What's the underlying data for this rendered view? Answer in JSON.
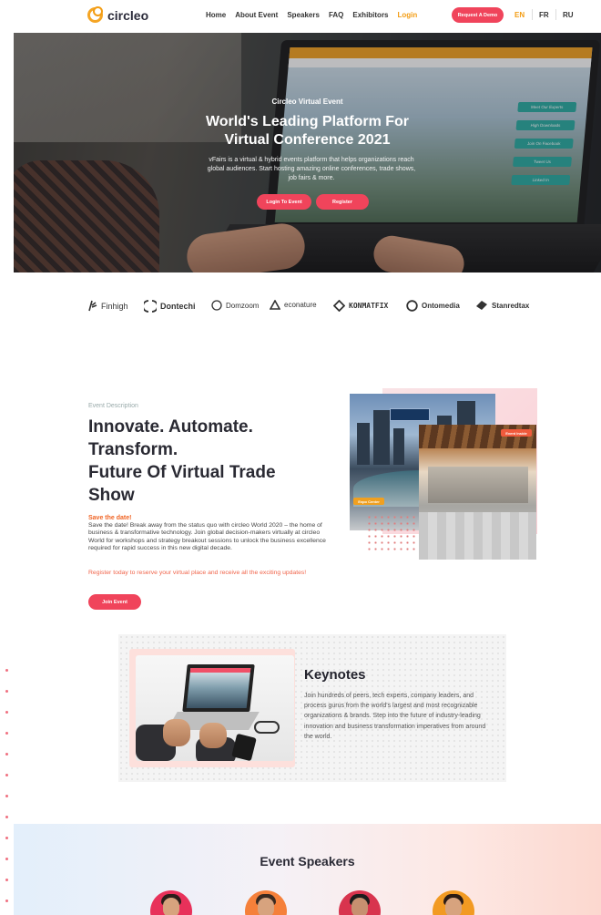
{
  "header": {
    "logo_text": "circleo",
    "nav": [
      "Home",
      "About Event",
      "Speakers",
      "FAQ",
      "Exhibitors",
      "Login"
    ],
    "demo_button": "Request A Demo",
    "languages": [
      "EN",
      "FR",
      "RU"
    ],
    "active_language": "EN"
  },
  "hero": {
    "eyebrow": "Circleo Virtual Event",
    "title_line1": "World's Leading Platform For",
    "title_line2": "Virtual Conference 2021",
    "description": "vFairs is a virtual & hybrid events platform that helps organizations reach global audiences. Start hosting amazing online conferences, trade shows, job fairs & more.",
    "login_button": "Login To Event",
    "register_button": "Register",
    "screen_panels": [
      "Meet Our Experts",
      "High Downloads",
      "Join On Facebook",
      "Tweet Us",
      "Linked In"
    ]
  },
  "partners": [
    "Finhigh",
    "Dontechi",
    "Domzoom",
    "econature",
    "KONMATFIX",
    "Ontomedia",
    "Stanredtax"
  ],
  "event": {
    "eyebrow": "Event Description",
    "title_lines": [
      "Innovate. Automate.",
      "Transform.",
      "Future Of Virtual Trade",
      "Show"
    ],
    "save_heading": "Save the date!",
    "body": "Save the date! Break away from the status quo with circleo World 2020 – the home of business & transformative technology. Join global decision-makers virtually at circleo World for workshops and strategy breakout sessions to unlock the business excellence required for rapid success in this new digital decade.",
    "register_text": "Register today to reserve your virtual place and receive all the exciting updates!",
    "join_button": "Join Event",
    "image_tags": [
      "Event Inside",
      "Expo Center"
    ]
  },
  "keynotes": {
    "title": "Keynotes",
    "text": "Join hundreds of peers, tech experts, company leaders, and process gurus from the world's largest and most recognizable organizations & brands. Step into the future of industry-leading innovation and business transformation imperatives from around the world."
  },
  "speakers": {
    "title": "Event Speakers"
  },
  "colors": {
    "accent_red": "#f0445b",
    "accent_orange": "#f39c12",
    "heading": "#2a2a33"
  }
}
